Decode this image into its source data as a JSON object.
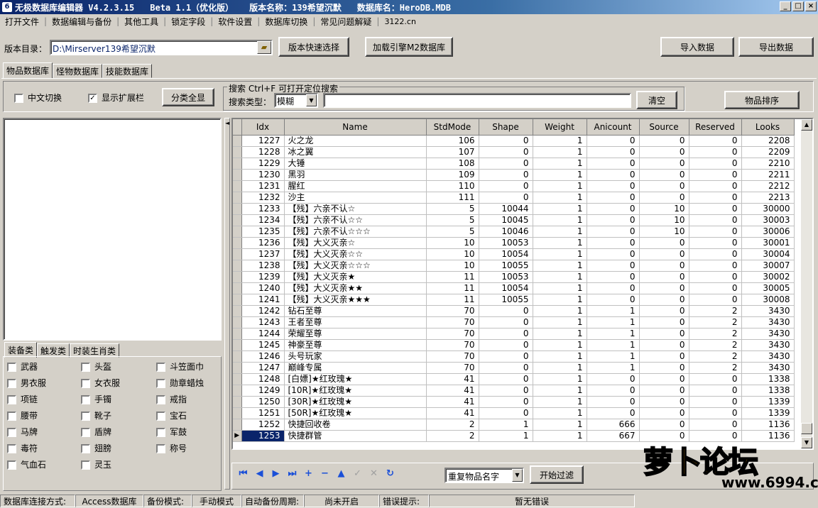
{
  "titlebar": {
    "app": "无极数据库编辑器 V4.2.3.15",
    "beta": "Beta 1.1（优化版）",
    "version": "版本名称：139希望沉默",
    "db": "数据库名：HeroDB.MDB",
    "buttons": [
      "_",
      "□",
      "×"
    ]
  },
  "menu": [
    "打开文件",
    "数据编辑与备份",
    "其他工具",
    "锁定字段",
    "软件设置",
    "数据库切换",
    "常见问题解疑",
    "3122.cn"
  ],
  "toolbar": {
    "dir_label": "版本目录：",
    "dir_value": "D:\\Mirserver139希望沉默",
    "quick_select": "版本快速选择",
    "load_engine": "加载引擎M2数据库",
    "import": "导入数据",
    "export": "导出数据"
  },
  "db_tabs": [
    "物品数据库",
    "怪物数据库",
    "技能数据库"
  ],
  "options": {
    "chinese_switch": "中文切换",
    "show_ext": "显示扩展栏",
    "show_all": "分类全显",
    "search_group": "搜索  Ctrl+F 可打开定位搜索",
    "search_type_label": "搜索类型：",
    "search_type_value": "模糊",
    "clear": "清空",
    "sort": "物品排序"
  },
  "category_tabs": [
    "装备类",
    "触发类",
    "时装生肖类"
  ],
  "equip_items": [
    [
      "武器",
      "头盔",
      "斗笠面巾"
    ],
    [
      "男衣服",
      "女衣服",
      "勋章蜡烛"
    ],
    [
      "项链",
      "手镯",
      "戒指"
    ],
    [
      "腰带",
      "靴子",
      "宝石"
    ],
    [
      "马牌",
      "盾牌",
      "军鼓"
    ],
    [
      "毒符",
      "翅膀",
      "称号"
    ],
    [
      "气血石",
      "灵玉",
      ""
    ]
  ],
  "grid": {
    "columns": [
      "Idx",
      "Name",
      "StdMode",
      "Shape",
      "Weight",
      "Anicount",
      "Source",
      "Reserved",
      "Looks"
    ],
    "rows": [
      [
        "1227",
        "火之龙",
        "106",
        "0",
        "1",
        "0",
        "0",
        "0",
        "2208"
      ],
      [
        "1228",
        "冰之翼",
        "107",
        "0",
        "1",
        "0",
        "0",
        "0",
        "2209"
      ],
      [
        "1229",
        "大锤",
        "108",
        "0",
        "1",
        "0",
        "0",
        "0",
        "2210"
      ],
      [
        "1230",
        "黑羽",
        "109",
        "0",
        "1",
        "0",
        "0",
        "0",
        "2211"
      ],
      [
        "1231",
        "腥红",
        "110",
        "0",
        "1",
        "0",
        "0",
        "0",
        "2212"
      ],
      [
        "1232",
        "沙主",
        "111",
        "0",
        "1",
        "0",
        "0",
        "0",
        "2213"
      ],
      [
        "1233",
        "【残】六亲不认☆",
        "5",
        "10044",
        "1",
        "0",
        "10",
        "0",
        "30000"
      ],
      [
        "1234",
        "【残】六亲不认☆☆",
        "5",
        "10045",
        "1",
        "0",
        "10",
        "0",
        "30003"
      ],
      [
        "1235",
        "【残】六亲不认☆☆☆",
        "5",
        "10046",
        "1",
        "0",
        "10",
        "0",
        "30006"
      ],
      [
        "1236",
        "【残】大义灭亲☆",
        "10",
        "10053",
        "1",
        "0",
        "0",
        "0",
        "30001"
      ],
      [
        "1237",
        "【残】大义灭亲☆☆",
        "10",
        "10054",
        "1",
        "0",
        "0",
        "0",
        "30004"
      ],
      [
        "1238",
        "【残】大义灭亲☆☆☆",
        "10",
        "10055",
        "1",
        "0",
        "0",
        "0",
        "30007"
      ],
      [
        "1239",
        "【残】大义灭亲★",
        "11",
        "10053",
        "1",
        "0",
        "0",
        "0",
        "30002"
      ],
      [
        "1240",
        "【残】大义灭亲★★",
        "11",
        "10054",
        "1",
        "0",
        "0",
        "0",
        "30005"
      ],
      [
        "1241",
        "【残】大义灭亲★★★",
        "11",
        "10055",
        "1",
        "0",
        "0",
        "0",
        "30008"
      ],
      [
        "1242",
        "钻石至尊",
        "70",
        "0",
        "1",
        "1",
        "0",
        "2",
        "3430"
      ],
      [
        "1243",
        "王者至尊",
        "70",
        "0",
        "1",
        "1",
        "0",
        "2",
        "3430"
      ],
      [
        "1244",
        "荣耀至尊",
        "70",
        "0",
        "1",
        "1",
        "0",
        "2",
        "3430"
      ],
      [
        "1245",
        "神豪至尊",
        "70",
        "0",
        "1",
        "1",
        "0",
        "2",
        "3430"
      ],
      [
        "1246",
        "头号玩家",
        "70",
        "0",
        "1",
        "1",
        "0",
        "2",
        "3430"
      ],
      [
        "1247",
        "巅峰专属",
        "70",
        "0",
        "1",
        "1",
        "0",
        "2",
        "3430"
      ],
      [
        "1248",
        "[白嫖]★红玫瑰★",
        "41",
        "0",
        "1",
        "0",
        "0",
        "0",
        "1338"
      ],
      [
        "1249",
        "[10R]★红玫瑰★",
        "41",
        "0",
        "1",
        "0",
        "0",
        "0",
        "1338"
      ],
      [
        "1250",
        "[30R]★红玫瑰★",
        "41",
        "0",
        "1",
        "0",
        "0",
        "0",
        "1339"
      ],
      [
        "1251",
        "[50R]★红玫瑰★",
        "41",
        "0",
        "1",
        "0",
        "0",
        "0",
        "1339"
      ],
      [
        "1252",
        "快捷回收卷",
        "2",
        "1",
        "1",
        "666",
        "0",
        "0",
        "1136"
      ],
      [
        "1253",
        "快捷群管",
        "2",
        "1",
        "1",
        "667",
        "0",
        "0",
        "1136"
      ]
    ],
    "selected_row": 26
  },
  "bottom": {
    "dup_select": "重复物品名字",
    "filter": "开始过滤"
  },
  "status": {
    "conn_label": "数据库连接方式:",
    "conn_value": "Access数据库",
    "backup_label": "备份模式:",
    "backup_value": "手动模式",
    "auto_label": "自动备份周期:",
    "auto_value": "尚未开启",
    "err_label": "错误提示:",
    "err_value": "暂无错误"
  },
  "watermark": "萝卜论坛 www.6994.cn"
}
